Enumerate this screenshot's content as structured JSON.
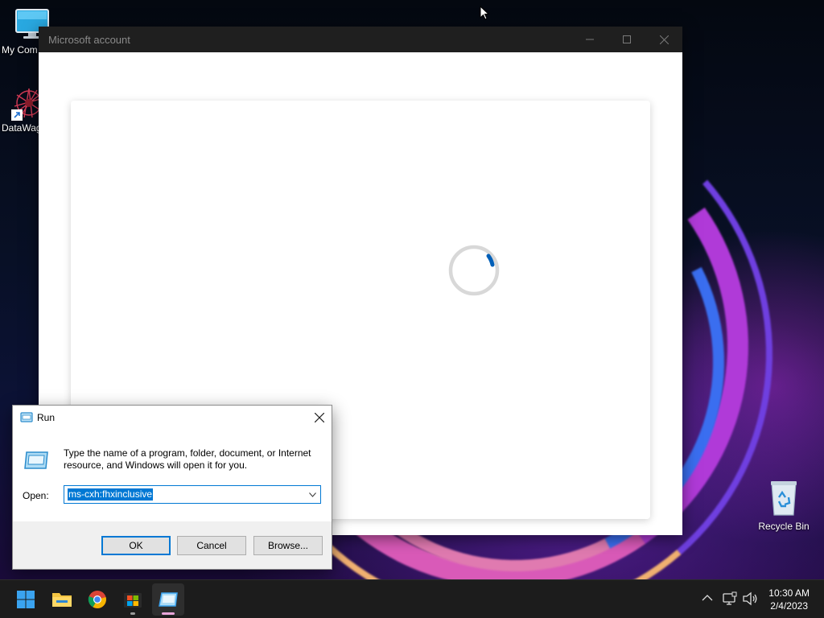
{
  "desktop": {
    "icons": [
      {
        "label": "My Com",
        "icon": "monitor-icon"
      },
      {
        "label": "DataWag",
        "icon": "datawag-app-icon"
      },
      {
        "label": "Recycle Bin",
        "icon": "recycle-bin-icon"
      }
    ]
  },
  "ms_window": {
    "title": "Microsoft account",
    "controls": {
      "minimize": "—",
      "maximize": "☐",
      "close": "✕"
    },
    "spinner_color": "#005fb8"
  },
  "run_dialog": {
    "title": "Run",
    "description": "Type the name of a program, folder, document, or Internet resource, and Windows will open it for you.",
    "open_label": "Open:",
    "open_value": "ms-cxh:fhxinclusive",
    "buttons": {
      "ok": "OK",
      "cancel": "Cancel",
      "browse": "Browse..."
    },
    "accent": "#0078d4"
  },
  "taskbar": {
    "apps": [
      {
        "icon": "windows-start-icon"
      },
      {
        "icon": "file-explorer-icon"
      },
      {
        "icon": "chrome-icon"
      },
      {
        "icon": "microsoft-store-icon"
      },
      {
        "icon": "run-icon",
        "active": true
      }
    ],
    "tray": {
      "chevron": "^",
      "time": "10:30 AM",
      "date": "2/4/2023"
    }
  }
}
